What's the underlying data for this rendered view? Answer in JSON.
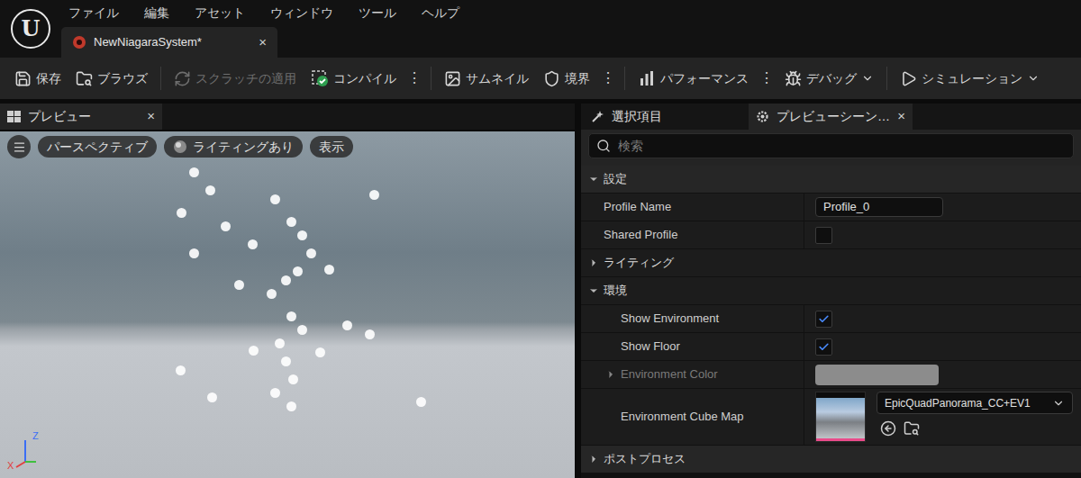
{
  "app": {
    "logo": "U",
    "menu": [
      "ファイル",
      "編集",
      "アセット",
      "ウィンドウ",
      "ツール",
      "ヘルプ"
    ]
  },
  "document_tab": {
    "label": "NewNiagaraSystem*",
    "close": "×",
    "selected": true
  },
  "toolbar": [
    [
      {
        "kind": "button",
        "label": "保存",
        "disabled": false,
        "dropdown": false
      },
      {
        "kind": "button",
        "label": "ブラウズ",
        "disabled": false,
        "dropdown": false
      }
    ],
    [
      {
        "kind": "button",
        "label": "スクラッチの適用",
        "disabled": true,
        "dropdown": false
      },
      {
        "kind": "button",
        "label": "コンパイル",
        "disabled": false,
        "dropdown": false
      },
      {
        "kind": "more",
        "label": "⋮",
        "disabled": false,
        "dropdown": false
      }
    ],
    [
      {
        "kind": "button",
        "label": "サムネイル",
        "disabled": false,
        "dropdown": false
      },
      {
        "kind": "button",
        "label": "境界",
        "disabled": false,
        "dropdown": false
      },
      {
        "kind": "more",
        "label": "⋮",
        "disabled": false,
        "dropdown": false
      }
    ],
    [
      {
        "kind": "button",
        "label": "パフォーマンス",
        "disabled": false,
        "dropdown": false
      },
      {
        "kind": "more",
        "label": "⋮",
        "disabled": false,
        "dropdown": false
      },
      {
        "kind": "button",
        "label": "デバッグ",
        "disabled": false,
        "dropdown": true
      }
    ],
    [
      {
        "kind": "button",
        "label": "シミュレーション",
        "disabled": false,
        "dropdown": true
      }
    ]
  ],
  "preview_panel": {
    "tab": {
      "label": "プレビュー",
      "close": "×",
      "selected": true
    },
    "viewport_buttons": [
      {
        "label": "パースペクティブ"
      },
      {
        "label": "ライティングあり"
      },
      {
        "label": "表示"
      }
    ],
    "axis": {
      "z": "Z",
      "x": "X"
    }
  },
  "details_panel": {
    "tabs": [
      {
        "label": "選択項目",
        "selected": false,
        "close": ""
      },
      {
        "label": "プレビューシーン…",
        "selected": true,
        "close": "×"
      }
    ],
    "search": {
      "placeholder": "検索"
    },
    "properties": [
      {
        "kind": "category",
        "label": "設定",
        "expanded": true,
        "children": [
          {
            "kind": "text",
            "label": "Profile Name",
            "value": "Profile_0"
          },
          {
            "kind": "checkbox",
            "label": "Shared Profile",
            "checked": false
          },
          {
            "kind": "category",
            "label": "ライティング",
            "expanded": false,
            "children": []
          },
          {
            "kind": "category",
            "label": "環境",
            "expanded": true,
            "children": [
              {
                "kind": "checkbox",
                "label": "Show Environment",
                "checked": true
              },
              {
                "kind": "checkbox",
                "label": "Show Floor",
                "checked": true
              },
              {
                "kind": "color",
                "label": "Environment Color",
                "disabled": true,
                "expanded": false,
                "color": "#8c8c8c"
              },
              {
                "kind": "asset",
                "label": "Environment Cube Map",
                "value": "EpicQuadPanorama_CC+EV1"
              }
            ]
          }
        ]
      },
      {
        "kind": "category",
        "label": "ポストプロセス",
        "expanded": false,
        "children": []
      }
    ]
  }
}
